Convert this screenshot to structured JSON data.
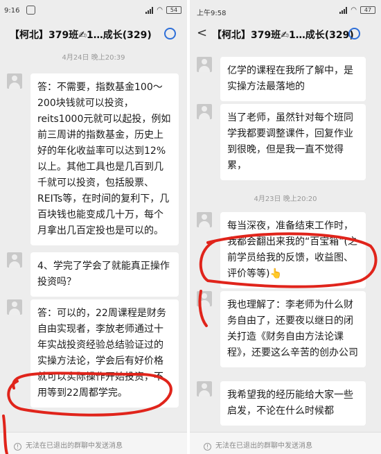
{
  "left": {
    "status": {
      "time": "9:16",
      "battery": "54"
    },
    "title": "【柯北】379班✍1…成长(329)",
    "timestamp": "4月24日 晚上20:39",
    "messages": [
      "答：不需要，指数基金100～200块钱就可以投资，reits1000元就可以起投，例如前三周讲的指数基金，历史上好的年化收益率可以达到12%以上。其他工具也是几百到几千就可以投资，包括股票、REITs等，在时间的复利下，几百块钱也能变成几十万，每个月拿出几百定投也是可以的。",
      "4、学完了学会了就能真正操作投资吗？",
      "答：可以的，22周课程是财务自由实现者，李放老师通过十年实战投资经验总结验证过的实操方法论，学会后有好价格就可以实际操作开始投资，不用等到22周都学完。"
    ],
    "footer": "无法在已退出的群聊中发送消息"
  },
  "right": {
    "status": {
      "time": "上午9:58",
      "battery": "47"
    },
    "title": "【柯北】379班✍1…成长(329)",
    "timestamp": "4月23日 晚上20:20",
    "messages": [
      "亿学的课程在我所了解中，是实操方法最落地的",
      "当了老师，虽然针对每个班同学我都要调整课件，回复作业到很晚，但是我一直不觉得累，",
      "每当深夜，准备结束工作时，我都会翻出来我的“百宝箱”(之前学员给我的反馈，收益图、评价等等)👆",
      "我也理解了：李老师为什么财务自由了，还要夜以继日的闭关打造《财务自由方法论课程》，还要这么辛苦的创办公司",
      "我希望我的经历能给大家一些启发，不论在什么时候都"
    ],
    "footer": "无法在已退出的群聊中发送消息"
  },
  "colors": {
    "accent": "#2e6fd8",
    "annotation": "#e0241b"
  },
  "icons": [
    "back-arrow-icon",
    "group-icon",
    "info-icon"
  ]
}
